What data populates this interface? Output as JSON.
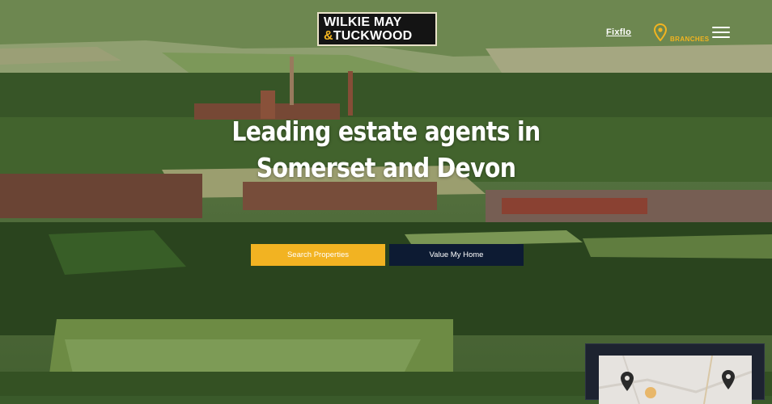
{
  "header": {
    "logo_line1": "WILKIE MAY",
    "logo_amp": "&",
    "logo_line2": "TUCKWOOD",
    "fixflo_label": "Fixflo",
    "branches_label": "BRANCHES"
  },
  "hero": {
    "title_line1": "Leading estate agents in",
    "title_line2": "Somerset and Devon",
    "search_button": "Search Properties",
    "value_button": "Value My Home"
  },
  "colors": {
    "accent": "#f2b322",
    "navy": "#0d1b33"
  },
  "icons": {
    "branches": "map-pin-icon",
    "menu": "hamburger-menu-icon"
  }
}
